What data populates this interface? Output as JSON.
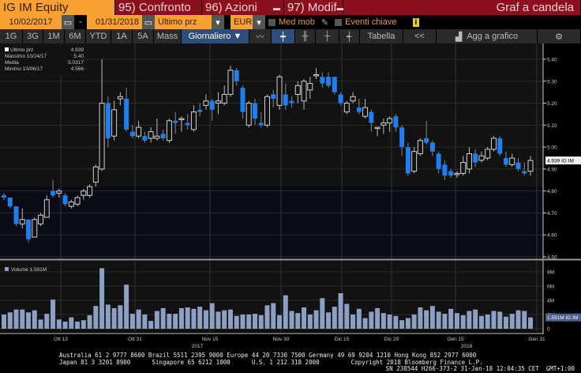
{
  "header": {
    "ticker": "IG IM Equity",
    "compare": "95) Confronto",
    "actions": "96) Azioni",
    "edit": "97) Modif",
    "chart_type": "Graf a candela"
  },
  "controls": {
    "start_date": "10/02/2017",
    "sep": "-",
    "end_date": "01/31/2018",
    "field": "Ultimo prz",
    "currency": "EUR",
    "moving_avg": "Med mob",
    "key_events": "Eventi chiave",
    "info": "i"
  },
  "toolbar": {
    "periods": [
      "1G",
      "3G",
      "1M",
      "6M",
      "YTD",
      "1A",
      "5A",
      "Mass"
    ],
    "frequency": "Giornaliero ▼",
    "table": "Tabella",
    "collapse": "<<",
    "add_to_chart": "Agg a grafico",
    "settings": "⚙"
  },
  "legend": {
    "last_label": "Ultimo prz",
    "last": "4.939",
    "high_label": "Massimo 10/24/17",
    "high": "5.40",
    "avg_label": "Media",
    "avg": "5.0317",
    "low_label": "Minimo 10/06/17",
    "low": "4.566"
  },
  "volume_legend": "Volume 1.591M",
  "chart_data": {
    "type": "candlestick",
    "price_axis": {
      "ticks": [
        "5.40",
        "5.30",
        "5.20",
        "5.10",
        "5.00",
        "4.90",
        "4.80",
        "4.70",
        "4.60",
        "4.50"
      ],
      "range": [
        4.5,
        5.45
      ]
    },
    "last_price_label": "4.939 IG IM",
    "volume_axis": {
      "ticks": [
        "8M",
        "6M",
        "4M",
        "2M",
        "0"
      ],
      "range": [
        0,
        9
      ]
    },
    "last_volume_label": "1.591M IG IM",
    "x_ticks": [
      "Ott 13",
      "Ott 31",
      "Nov 15",
      "Nov 30",
      "Dic 15",
      "Dic 29",
      "Gen 15",
      "Gen 31"
    ],
    "x_years": [
      "2017",
      "2018"
    ],
    "colors": {
      "up": "#d0d0d0",
      "down": "#1e7ff0",
      "volume": "#8da0c4"
    },
    "ohlc": [
      [
        4.78,
        4.79,
        4.76,
        4.77
      ],
      [
        4.77,
        4.77,
        4.72,
        4.73
      ],
      [
        4.73,
        4.73,
        4.64,
        4.65
      ],
      [
        4.65,
        4.72,
        4.63,
        4.67
      ],
      [
        4.67,
        4.67,
        4.566,
        4.58
      ],
      [
        4.59,
        4.68,
        4.59,
        4.67
      ],
      [
        4.65,
        4.7,
        4.64,
        4.69
      ],
      [
        4.68,
        4.78,
        4.68,
        4.76
      ],
      [
        4.8,
        4.85,
        4.77,
        4.78
      ],
      [
        4.79,
        4.81,
        4.77,
        4.8
      ],
      [
        4.78,
        4.79,
        4.73,
        4.74
      ],
      [
        4.73,
        4.76,
        4.72,
        4.75
      ],
      [
        4.74,
        4.78,
        4.73,
        4.77
      ],
      [
        4.78,
        4.81,
        4.76,
        4.8
      ],
      [
        4.78,
        4.83,
        4.77,
        4.82
      ],
      [
        4.84,
        4.92,
        4.82,
        4.91
      ],
      [
        4.9,
        5.4,
        4.89,
        5.2
      ],
      [
        5.2,
        5.23,
        5.0,
        5.04
      ],
      [
        5.05,
        5.21,
        5.03,
        5.17
      ],
      [
        5.22,
        5.25,
        5.19,
        5.23
      ],
      [
        5.22,
        5.27,
        5.07,
        5.08
      ],
      [
        5.07,
        5.1,
        5.04,
        5.05
      ],
      [
        5.05,
        5.12,
        5.04,
        5.09
      ],
      [
        5.05,
        5.07,
        5.02,
        5.03
      ],
      [
        5.04,
        5.09,
        5.02,
        5.07
      ],
      [
        5.04,
        5.13,
        5.03,
        5.05
      ],
      [
        5.06,
        5.08,
        5.03,
        5.04
      ],
      [
        5.03,
        5.13,
        5.02,
        5.12
      ],
      [
        5.12,
        5.16,
        5.06,
        5.11
      ],
      [
        5.13,
        5.14,
        5.07,
        5.13
      ],
      [
        5.11,
        5.15,
        5.08,
        5.1
      ],
      [
        5.08,
        5.19,
        5.07,
        5.16
      ],
      [
        5.17,
        5.2,
        5.14,
        5.16
      ],
      [
        5.19,
        5.24,
        5.17,
        5.21
      ],
      [
        5.21,
        5.22,
        5.12,
        5.17
      ],
      [
        5.2,
        5.25,
        5.15,
        5.21
      ],
      [
        5.2,
        5.28,
        5.19,
        5.24
      ],
      [
        5.24,
        5.37,
        5.23,
        5.35
      ],
      [
        5.35,
        5.36,
        5.28,
        5.3
      ],
      [
        5.27,
        5.28,
        5.13,
        5.16
      ],
      [
        5.1,
        5.21,
        5.09,
        5.2
      ],
      [
        5.2,
        5.22,
        5.1,
        5.13
      ],
      [
        5.11,
        5.16,
        5.09,
        5.1
      ],
      [
        5.1,
        5.24,
        5.09,
        5.23
      ],
      [
        5.24,
        5.26,
        5.18,
        5.22
      ],
      [
        5.19,
        5.33,
        5.17,
        5.32
      ],
      [
        5.24,
        5.29,
        5.17,
        5.19
      ],
      [
        5.21,
        5.23,
        5.18,
        5.2
      ],
      [
        5.24,
        5.3,
        5.2,
        5.28
      ],
      [
        5.21,
        5.31,
        5.17,
        5.3
      ],
      [
        5.26,
        5.32,
        5.22,
        5.29
      ],
      [
        5.33,
        5.36,
        5.31,
        5.33
      ],
      [
        5.32,
        5.34,
        5.27,
        5.29
      ],
      [
        5.32,
        5.34,
        5.27,
        5.28
      ],
      [
        5.32,
        5.32,
        5.24,
        5.25
      ],
      [
        5.24,
        5.25,
        5.19,
        5.2
      ],
      [
        5.16,
        5.21,
        5.15,
        5.2
      ],
      [
        5.21,
        5.25,
        5.2,
        5.23
      ],
      [
        5.18,
        5.22,
        5.15,
        5.16
      ],
      [
        5.14,
        5.22,
        5.13,
        5.18
      ],
      [
        5.16,
        5.17,
        5.07,
        5.11
      ],
      [
        5.09,
        5.09,
        5.05,
        5.09
      ],
      [
        5.1,
        5.13,
        5.06,
        5.11
      ],
      [
        5.11,
        5.14,
        5.07,
        5.13
      ],
      [
        5.14,
        5.15,
        5.07,
        5.09
      ],
      [
        5.09,
        5.1,
        4.96,
        5.0
      ],
      [
        5.0,
        5.02,
        4.87,
        4.88
      ],
      [
        4.89,
        5.0,
        4.88,
        4.98
      ],
      [
        4.97,
        5.04,
        4.96,
        5.03
      ],
      [
        5.04,
        5.12,
        5.01,
        5.02
      ],
      [
        5.02,
        5.03,
        4.96,
        4.98
      ],
      [
        4.97,
        4.98,
        4.88,
        4.9
      ],
      [
        4.92,
        4.94,
        4.85,
        4.87
      ],
      [
        4.89,
        4.9,
        4.86,
        4.87
      ],
      [
        4.88,
        4.89,
        4.86,
        4.88
      ],
      [
        4.88,
        4.96,
        4.87,
        4.93
      ],
      [
        4.9,
        5.0,
        4.88,
        4.97
      ],
      [
        4.97,
        4.99,
        4.91,
        4.93
      ],
      [
        4.94,
        4.98,
        4.93,
        4.96
      ],
      [
        4.95,
        5.0,
        4.94,
        4.99
      ],
      [
        4.99,
        5.05,
        4.98,
        5.04
      ],
      [
        5.04,
        5.05,
        4.96,
        4.97
      ],
      [
        4.95,
        4.98,
        4.91,
        4.92
      ],
      [
        4.92,
        4.97,
        4.91,
        4.95
      ],
      [
        4.93,
        4.95,
        4.89,
        4.9
      ],
      [
        4.89,
        4.93,
        4.87,
        4.88
      ],
      [
        4.89,
        4.96,
        4.87,
        4.939
      ]
    ],
    "volume": [
      2.0,
      2.3,
      2.7,
      2.7,
      2.3,
      2.6,
      1.3,
      2.1,
      4.1,
      1.3,
      1.0,
      1.6,
      1.0,
      1.2,
      1.9,
      3.2,
      8.5,
      3.4,
      2.9,
      3.3,
      6.2,
      2.1,
      2.7,
      2.0,
      1.1,
      2.5,
      2.9,
      2.1,
      2.1,
      2.9,
      3.0,
      2.8,
      3.1,
      2.6,
      3.6,
      2.4,
      2.6,
      2.7,
      1.8,
      2.0,
      2.0,
      2.1,
      1.9,
      3.3,
      3.6,
      1.9,
      4.7,
      2.5,
      2.2,
      3.0,
      2.0,
      2.6,
      4.3,
      2.3,
      3.1,
      5.0,
      3.5,
      2.0,
      2.8,
      1.5,
      2.4,
      2.9,
      2.2,
      2.0,
      1.8,
      1.2,
      1.5,
      2.0,
      3.0,
      2.6,
      3.2,
      2.4,
      2.1,
      2.8,
      2.2,
      1.9,
      2.5,
      2.7,
      1.8,
      2.0,
      2.5,
      2.4,
      1.7,
      2.1,
      2.6,
      2.5,
      1.591
    ]
  },
  "footer": {
    "line1": "Australia 61 2 9777 8600 Brazil 5511 2395 9000 Europe 44 20 7330 7500 Germany 49 69 9204 1210 Hong Kong 852 2977 6000",
    "line2a": "Japan 81 3 3201 8900      Singapore 65 6212 1000      U.S. 1 212 318 2000",
    "line2b": "Copyright 2018 Bloomberg Finance L.P.",
    "line3": "SN 238544 H266-373-2 31-Jan-18 12:04:35 CET  GMT+1:00"
  }
}
